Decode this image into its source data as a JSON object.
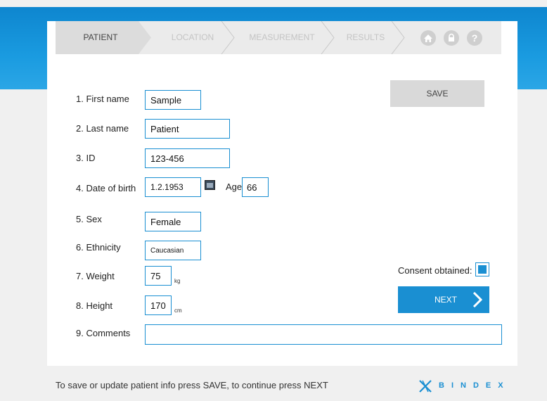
{
  "wizard": {
    "steps": [
      {
        "label": "PATIENT",
        "active": true
      },
      {
        "label": "LOCATION",
        "active": false
      },
      {
        "label": "MEASUREMENT",
        "active": false
      },
      {
        "label": "RESULTS",
        "active": false
      }
    ],
    "icons": [
      "home-icon",
      "lock-icon",
      "help-icon"
    ]
  },
  "form": {
    "first_name": {
      "label": "1. First name",
      "value": "Sample"
    },
    "last_name": {
      "label": "2. Last name",
      "value": "Patient"
    },
    "id": {
      "label": "3. ID",
      "value": "123-456"
    },
    "dob": {
      "label": "4. Date of birth",
      "value": "1.2.1953",
      "age_label": "Age",
      "age_value": "66"
    },
    "sex": {
      "label": "5. Sex",
      "value": "Female"
    },
    "ethnicity": {
      "label": "6. Ethnicity",
      "value": "Caucasian"
    },
    "weight": {
      "label": "7. Weight",
      "value": "75",
      "unit": "kg"
    },
    "height": {
      "label": "8. Height",
      "value": "170",
      "unit": "cm"
    },
    "comments": {
      "label": "9. Comments",
      "value": ""
    }
  },
  "actions": {
    "save_label": "SAVE",
    "next_label": "NEXT",
    "consent_label": "Consent obtained:",
    "consent_checked": true
  },
  "footer": {
    "hint": "To save or update patient info press SAVE, to continue press NEXT",
    "brand": "BINDEX"
  },
  "colors": {
    "accent": "#1a8fd2",
    "band": "#1a9be0"
  }
}
